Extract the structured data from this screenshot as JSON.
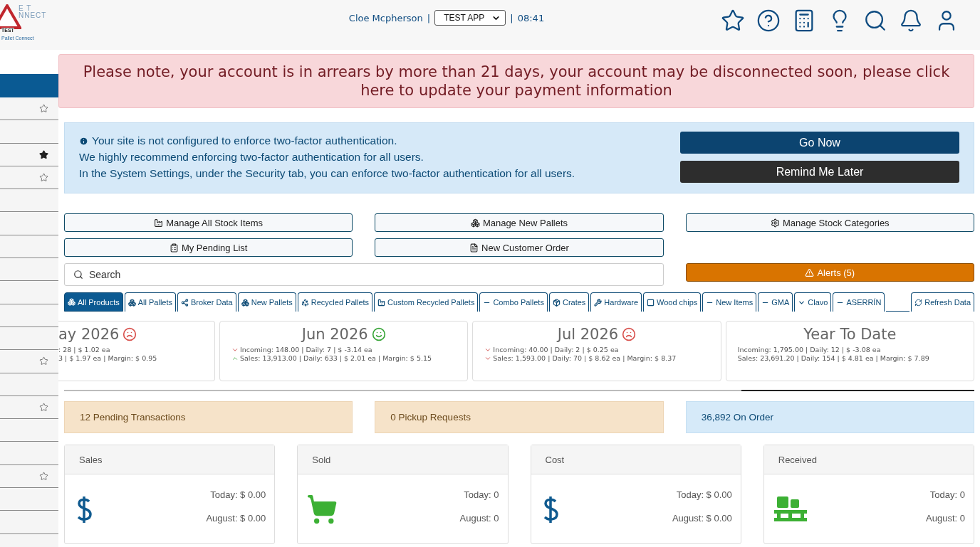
{
  "logo": {
    "letters_top": "E T",
    "letters_mid": "NNECT",
    "badge": "TEST",
    "caption": "Pallet Connect"
  },
  "header": {
    "user": "Cloe Mcpherson",
    "separator_1": "|",
    "app_select": "TEST APP",
    "separator_2": "|",
    "time": "08:41"
  },
  "sidebar": {
    "items": [
      {
        "star_shown": true,
        "starred": false
      },
      {
        "star_shown": false
      },
      {
        "star_shown": true,
        "starred": true
      },
      {
        "star_shown": true,
        "starred": false
      },
      {
        "star_shown": false
      },
      {
        "star_shown": false
      },
      {
        "star_shown": false
      },
      {
        "star_shown": false
      },
      {
        "star_shown": false
      },
      {
        "star_shown": false
      },
      {
        "star_shown": false
      },
      {
        "star_shown": true,
        "starred": false
      },
      {
        "star_shown": false
      },
      {
        "star_shown": true,
        "starred": false
      },
      {
        "star_shown": false
      },
      {
        "star_shown": false
      },
      {
        "star_shown": true,
        "starred": false
      },
      {
        "star_shown": false
      },
      {
        "star_shown": false
      },
      {
        "star_shown": false
      }
    ]
  },
  "arrears_notice": "Please note, your account is in arrears by more than 21 days, your account may be disconnected soon, please click here to update your payment information",
  "two_factor": {
    "lines": [
      "Your site is not configured to enforce two-factor authentication.",
      "We highly recommend enforcing two-factor authentication for all users.",
      "In the System Settings, under the Security tab, you can enforce two-factor authentication for all users."
    ],
    "primary_button": "Go Now",
    "secondary_button": "Remind Me Later"
  },
  "action_buttons": [
    {
      "label": "Manage All Stock Items"
    },
    {
      "label": "Manage New Pallets"
    },
    {
      "label": "Manage Stock Categories"
    },
    {
      "label": "My Pending List"
    },
    {
      "label": "New Customer Order"
    }
  ],
  "search": {
    "placeholder": "Search"
  },
  "alerts_button": "Alerts (5)",
  "tabs": [
    {
      "label": "All Products",
      "selected": true
    },
    {
      "label": "All Pallets",
      "selected": false
    },
    {
      "label": "Broker Data",
      "selected": false
    },
    {
      "label": "New Pallets",
      "selected": false
    },
    {
      "label": "Recycled Pallets",
      "selected": false
    },
    {
      "label": "Custom Recycled Pallets",
      "selected": false
    },
    {
      "label": "Combo Pallets",
      "selected": false
    },
    {
      "label": "Crates",
      "selected": false
    },
    {
      "label": "Hardware",
      "selected": false
    },
    {
      "label": "Wood chips",
      "selected": false
    },
    {
      "label": "New Items",
      "selected": false
    },
    {
      "label": "GMA",
      "selected": false
    },
    {
      "label": "Clavo",
      "selected": false
    },
    {
      "label": "ASERRÍN",
      "selected": false
    }
  ],
  "refresh_button": "Refresh Data",
  "periods": [
    {
      "title": "ay 2026",
      "kind": "sad",
      "lines": [
        {
          "kind": "plain",
          "text": ": 28 | $ 1.02 ea"
        },
        {
          "kind": "plain",
          "text": "3 | $ 1.97 ea | Margin: $ 0.95"
        }
      ]
    },
    {
      "title": "Jun 2026",
      "kind": "happy",
      "lines": [
        {
          "kind": "down",
          "text": "Incoming: 148.00 | Daily: 7 | $ -3.14 ea"
        },
        {
          "kind": "up",
          "text": "Sales: 13,913.00 | Daily: 633 | $ 2.01 ea | Margin: $ 5.15"
        }
      ]
    },
    {
      "title": "Jul 2026",
      "kind": "sad",
      "lines": [
        {
          "kind": "down",
          "text": "Incoming: 40.00 | Daily: 2 | $ 0.25 ea"
        },
        {
          "kind": "down",
          "text": "Sales: 1,593.00 | Daily: 70 | $ 8.62 ea | Margin: $ 8.37"
        }
      ]
    },
    {
      "title": "Year To Date",
      "kind": "plain",
      "lines": [
        {
          "kind": "plain",
          "text": "Incoming: 1,795.00 | Daily: 12 | $ -3.08 ea"
        },
        {
          "kind": "plain",
          "text": "Sales: 23,691.20 | Daily: 154 | $ 4.81 ea | Margin: $ 7.89"
        }
      ]
    }
  ],
  "status_boxes": [
    {
      "text": "12 Pending Transactions",
      "kind": "warning"
    },
    {
      "text": "0 Pickup Requests",
      "kind": "warning"
    },
    {
      "text": "36,892 On Order",
      "kind": "info"
    }
  ],
  "summary_cards": [
    {
      "title": "Sales",
      "kind": "dollar",
      "today": "Today: $ 0.00",
      "month": "August: $ 0.00"
    },
    {
      "title": "Sold",
      "kind": "cart",
      "today": "Today: 0",
      "month": "August: 0"
    },
    {
      "title": "Cost",
      "kind": "dollar",
      "today": "Today: $ 0.00",
      "month": "August: $ 0.00"
    },
    {
      "title": "Received",
      "kind": "pallet",
      "today": "Today: 0",
      "month": "August: 0"
    }
  ]
}
